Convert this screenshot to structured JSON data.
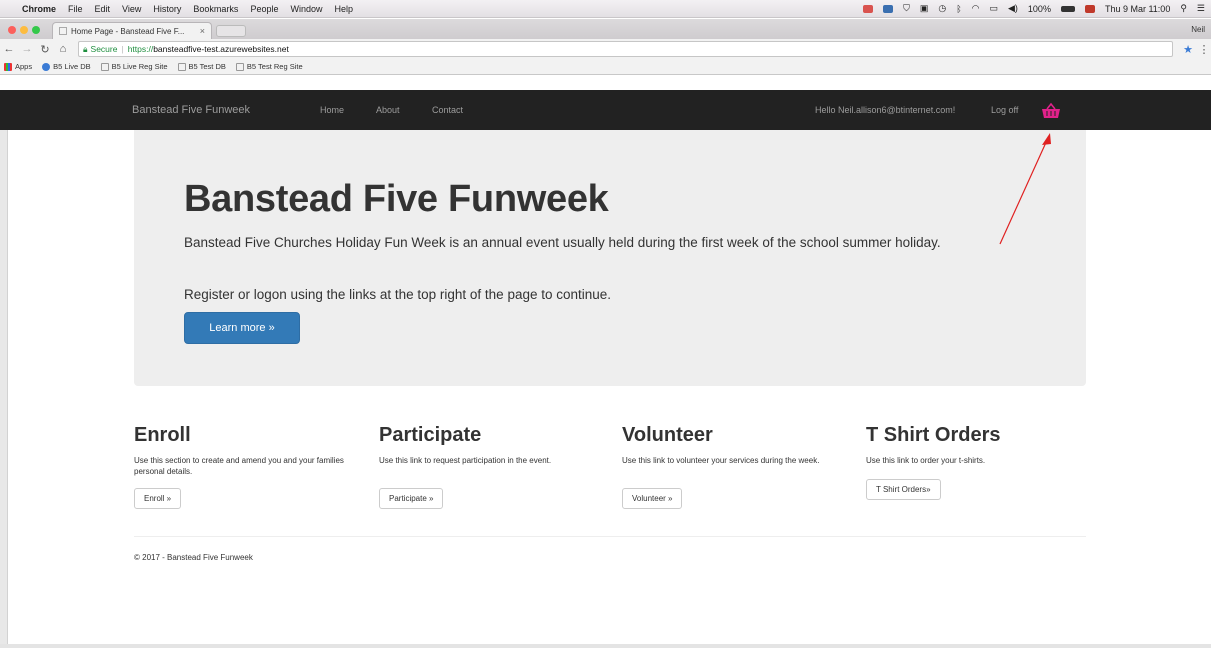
{
  "menubar": {
    "app": "Chrome",
    "items": [
      "File",
      "Edit",
      "View",
      "History",
      "Bookmarks",
      "People",
      "Window",
      "Help"
    ],
    "battery": "100%",
    "datetime": "Thu 9 Mar 11:00"
  },
  "browser": {
    "tab_title": "Home Page - Banstead Five F...",
    "tab_close": "×",
    "profile": "Neil",
    "secure_label": "Secure",
    "url_scheme": "https://",
    "url_host": "bansteadfive-test.azurewebsites.net",
    "bookmarks": [
      "Apps",
      "B5 Live DB",
      "B5 Live Reg Site",
      "B5 Test DB",
      "B5 Test Reg Site"
    ]
  },
  "navbar": {
    "brand": "Banstead Five Funweek",
    "links": [
      "Home",
      "About",
      "Contact"
    ],
    "greeting": "Hello Neil.allison6@btinternet.com!",
    "logoff": "Log off"
  },
  "jumbotron": {
    "title": "Banstead Five Funweek",
    "lead": "Banstead Five Churches Holiday Fun Week is an annual event usually held during the first week of the school summer holiday.",
    "register": "Register or logon using the links at the top right of the page to continue.",
    "button": "Learn more »"
  },
  "sections": [
    {
      "title": "Enroll",
      "text": "Use this section to create and amend you and your families personal details.",
      "button": "Enroll »"
    },
    {
      "title": "Participate",
      "text": "Use this link to request participation in the event.",
      "button": "Participate »"
    },
    {
      "title": "Volunteer",
      "text": "Use this link to volunteer your services during the week.",
      "button": "Volunteer »"
    },
    {
      "title": "T Shirt Orders",
      "text": "Use this link to order your t-shirts.",
      "button": "T Shirt Orders»"
    }
  ],
  "footer": "© 2017 - Banstead Five Funweek",
  "colors": {
    "navbar_bg": "#222222",
    "basket": "#e0218a",
    "primary_button": "#337ab7",
    "jumbotron_bg": "#eeeeee",
    "annotation_arrow": "#e02020"
  },
  "icons": {
    "basket": "shopping-basket-icon",
    "lock": "lock-icon",
    "star": "bookmark-star-icon"
  }
}
